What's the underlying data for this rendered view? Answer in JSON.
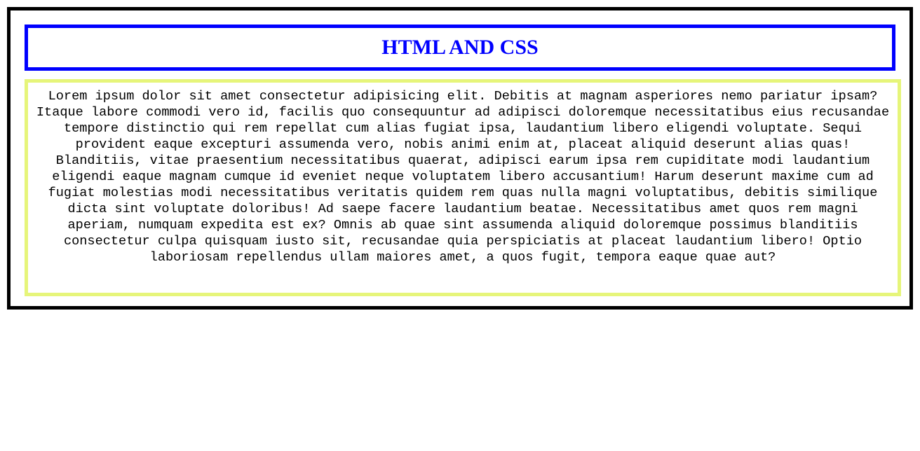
{
  "colors": {
    "outer_border": "#000000",
    "heading_border": "#0000ff",
    "heading_text": "#0000ff",
    "paragraph_border": "#e6f57a"
  },
  "header": {
    "title": "HTML AND CSS"
  },
  "main": {
    "paragraph": "Lorem ipsum dolor sit amet consectetur adipisicing elit. Debitis at magnam asperiores nemo pariatur ipsam? Itaque labore commodi vero id, facilis quo consequuntur ad adipisci doloremque necessitatibus eius recusandae tempore distinctio qui rem repellat cum alias fugiat ipsa, laudantium libero eligendi voluptate. Sequi provident eaque excepturi assumenda vero, nobis animi enim at, placeat aliquid deserunt alias quas! Blanditiis, vitae praesentium necessitatibus quaerat, adipisci earum ipsa rem cupiditate modi laudantium eligendi eaque magnam cumque id eveniet neque voluptatem libero accusantium! Harum deserunt maxime cum ad fugiat molestias modi necessitatibus veritatis quidem rem quas nulla magni voluptatibus, debitis similique dicta sint voluptate doloribus! Ad saepe facere laudantium beatae. Necessitatibus amet quos rem magni aperiam, numquam expedita est ex? Omnis ab quae sint assumenda aliquid doloremque possimus blanditiis consectetur culpa quisquam iusto sit, recusandae quia perspiciatis at placeat laudantium libero! Optio laboriosam repellendus ullam maiores amet, a quos fugit, tempora eaque quae aut?"
  }
}
